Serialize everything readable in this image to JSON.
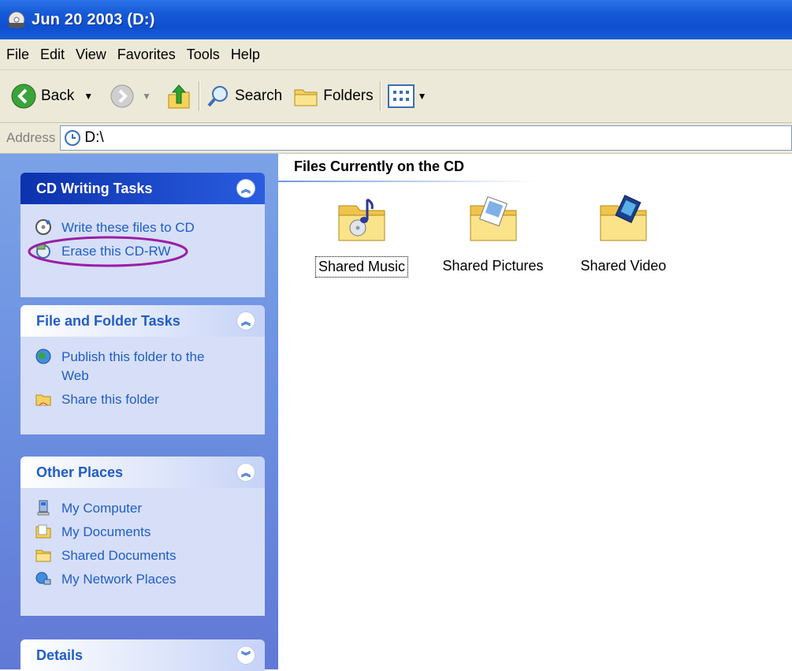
{
  "window": {
    "title": "Jun 20 2003 (D:)"
  },
  "menu": {
    "items": [
      "File",
      "Edit",
      "View",
      "Favorites",
      "Tools",
      "Help"
    ]
  },
  "toolbar": {
    "back_label": "Back",
    "search_label": "Search",
    "folders_label": "Folders"
  },
  "address": {
    "label": "Address",
    "value": "D:\\"
  },
  "left_pane": {
    "cd_tasks": {
      "title": "CD Writing Tasks",
      "items": [
        "Write these files to CD",
        "Erase this CD-RW"
      ]
    },
    "file_tasks": {
      "title": "File and Folder Tasks",
      "items": [
        "Publish this folder to the Web",
        "Share this folder"
      ]
    },
    "other_places": {
      "title": "Other Places",
      "items": [
        "My Computer",
        "My Documents",
        "Shared Documents",
        "My Network Places"
      ]
    },
    "details": {
      "title": "Details"
    }
  },
  "content": {
    "section_title": "Files Currently on the CD",
    "items": [
      {
        "name": "Shared Music"
      },
      {
        "name": "Shared Pictures"
      },
      {
        "name": "Shared Video"
      }
    ]
  },
  "colors": {
    "title_bar": "#0e4fcf",
    "task_link": "#215dc6",
    "pane": "#6b8fe0",
    "annotation": "#9b1ea6"
  }
}
